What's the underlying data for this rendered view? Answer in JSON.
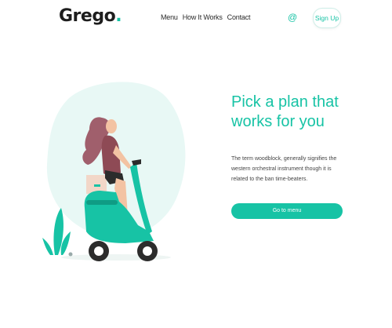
{
  "brand": {
    "name": "Grego",
    "dot": "."
  },
  "nav": {
    "items": [
      "Menu",
      "How It Works",
      "Contact"
    ]
  },
  "header": {
    "at_symbol": "@",
    "signup_label": "Sign Up"
  },
  "hero": {
    "headline": "Pick a plan that works for you",
    "description": "The term woodblock, generally signifies the western orchestral instrument though it is related to the ban time-beaters.",
    "cta_label": "Go to menu"
  },
  "colors": {
    "accent": "#17c3a5",
    "blob": "#e8f8f5",
    "text": "#1d1d1d"
  },
  "icons": {
    "contact_icon": "at-icon"
  }
}
